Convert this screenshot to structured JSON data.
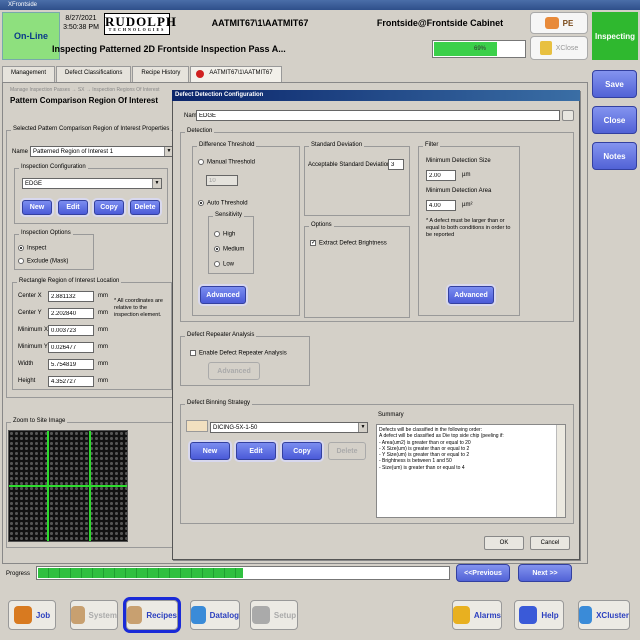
{
  "app": {
    "window_title": "XFrontside",
    "status": "On-Line",
    "date": "8/27/2021",
    "time": "3:50:38 PM",
    "logo": "RUDOLPH",
    "logo_sub": "TECHNOLOGIES",
    "recipe": "AATMIT67\\1\\AATMIT67",
    "user": "Frontside@Frontside Cabinet",
    "subtitle": "Inspecting Patterned 2D Frontside Inspection Pass A...",
    "progress_label": "69%",
    "progress_value": 0.69,
    "pe_label": "PE",
    "xclose_label": "XClose",
    "state": "Inspecting"
  },
  "tabs": [
    {
      "label": "Management"
    },
    {
      "label": "Defect Classifications"
    },
    {
      "label": "Recipe History"
    },
    {
      "label": "AATMIT67\\1\\AATMIT67"
    }
  ],
  "breadcrumb": "Manage Inspection Passes → SX → Inspection Regions Of Interest",
  "page_title": "Pattern Comparison Region Of Interest",
  "left": {
    "props_title": "Selected Pattern Comparison Region of Interest Properties",
    "name_label": "Name",
    "name_value": "Patterned Region of Interest 1",
    "inspection_config_title": "Inspection Configuration",
    "config_value": "EDGE",
    "buttons": [
      "New",
      "Edit",
      "Copy",
      "Delete"
    ],
    "inspection_options_title": "Inspection Options",
    "opt_inspect": "Inspect",
    "opt_exclude": "Exclude (Mask)",
    "rect_title": "Rectangle Region of Interest Location",
    "fields": [
      {
        "label": "Center X",
        "value": "2.881132",
        "unit": "mm"
      },
      {
        "label": "Center Y",
        "value": "2.202840",
        "unit": "mm"
      },
      {
        "label": "Minimum X",
        "value": "0.003723",
        "unit": "mm"
      },
      {
        "label": "Minimum Y",
        "value": "0.026477",
        "unit": "mm"
      },
      {
        "label": "Width",
        "value": "5.754819",
        "unit": "mm"
      },
      {
        "label": "Height",
        "value": "4.352727",
        "unit": "mm"
      }
    ],
    "note": "* All coordinates are relative to the inspection element.",
    "zoom_title": "Zoom to Site Image"
  },
  "dialog": {
    "title": "Defect Detection Configuration",
    "name_label": "Name:",
    "name_value": "EDGE",
    "detection_title": "Detection",
    "diff_title": "Difference Threshold",
    "manual": "Manual Threshold",
    "manual_value": "10",
    "auto": "Auto Threshold",
    "sens_title": "Sensitivity",
    "sens": [
      "High",
      "Medium",
      "Low"
    ],
    "advanced": "Advanced",
    "std_title": "Standard Deviation",
    "std_label": "Acceptable Standard Deviation",
    "std_value": "3",
    "options_title": "Options",
    "extract": "Extract Defect Brightness",
    "filter_title": "Filter",
    "min_size_label": "Minimum Detection Size",
    "min_size_value": "2.00",
    "min_size_unit": "µm",
    "min_area_label": "Minimum Detection Area",
    "min_area_value": "4.00",
    "min_area_unit": "µm²",
    "filter_note": "* A defect must be larger than or equal to both conditions in order to be reported",
    "repeater_title": "Defect Repeater Analysis",
    "repeater_chk": "Enable Defect Repeater Analysis",
    "repeater_adv": "Advanced",
    "binning_title": "Defect Binning Strategy",
    "binning_value": "DICING-5X-1-50",
    "binning_buttons": [
      "New",
      "Edit",
      "Copy",
      "Delete"
    ],
    "summary_title": "Summary",
    "summary_lines": [
      "Defects will be classified in the following order:",
      "A defect will be classified as Die top side chip (peeling if:",
      "- Area(um2) is greater than or equal to 20",
      "- X Size(um) is greater than or equal to 2",
      "- Y Size(um) is greater than or equal to 2",
      "- Brightness is between 1 and 50",
      "- Size(um) is greater than or equal to 4"
    ],
    "ok": "OK",
    "cancel": "Cancel"
  },
  "side": {
    "save": "Save",
    "close": "Close",
    "notes": "Notes"
  },
  "progress": {
    "label": "Progress",
    "prev": "<<Previous",
    "next": "Next >>",
    "fill": 0.5
  },
  "bottom": [
    {
      "label": "Job",
      "icon": "wrench-icon",
      "color": "#d87a20"
    },
    {
      "label": "System",
      "icon": "system-icon",
      "color": "#c8a070"
    },
    {
      "label": "Recipes",
      "icon": "recipes-icon",
      "color": "#c8a070"
    },
    {
      "label": "Datalog",
      "icon": "datalog-icon",
      "color": "#3a8bd8"
    },
    {
      "label": "Setup",
      "icon": "gear-icon",
      "color": "#aaa"
    },
    {
      "label": "Alarms",
      "icon": "warning-icon",
      "color": "#e8b020"
    },
    {
      "label": "Help",
      "icon": "help-icon",
      "color": "#3a5ad8"
    },
    {
      "label": "XCluster",
      "icon": "cluster-icon",
      "color": "#3a8bd8"
    }
  ]
}
